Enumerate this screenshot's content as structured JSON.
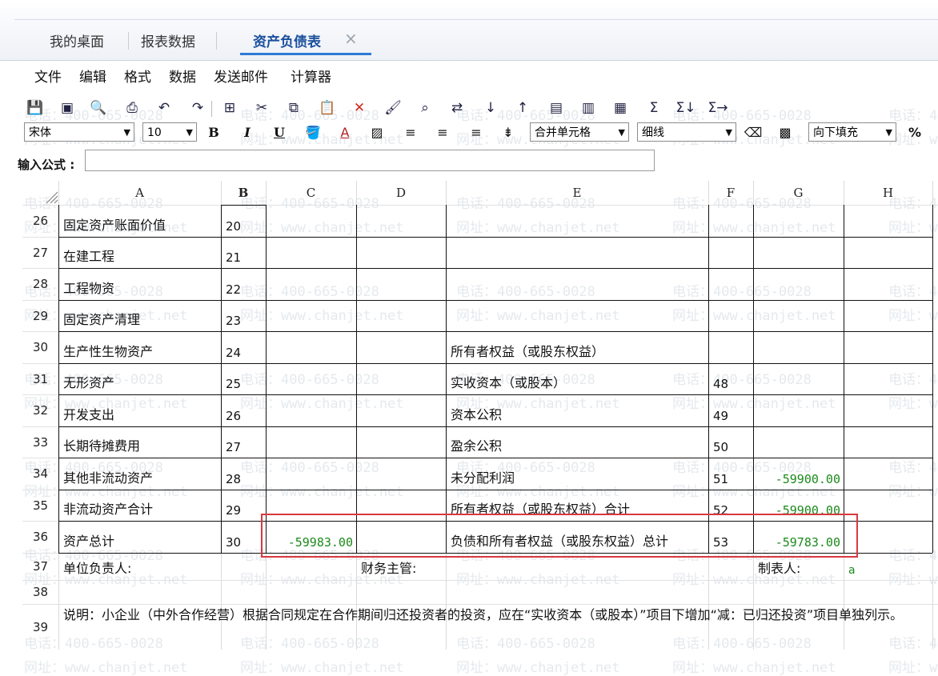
{
  "tabs": [
    {
      "label": "我的桌面",
      "active": false
    },
    {
      "label": "报表数据",
      "active": false
    },
    {
      "label": "资产负债表",
      "active": true
    }
  ],
  "tab_close_icon": "×",
  "menu": [
    "文件",
    "编辑",
    "格式",
    "数据",
    "发送邮件",
    "计算器"
  ],
  "toolbar": {
    "icons": [
      "save-icon",
      "save-as-icon",
      "print-preview-icon",
      "print-icon",
      "undo-icon",
      "redo-icon",
      "select-all-icon",
      "cut-icon",
      "copy-icon",
      "paste-icon",
      "delete-icon",
      "format-painter-icon",
      "find-icon",
      "replace-icon",
      "sort-asc-icon",
      "sort-desc-icon",
      "paste-special-icon",
      "paste-values-icon",
      "insert-icon",
      "sum-icon",
      "sum-row-icon",
      "sum-col-icon"
    ],
    "font": "宋体",
    "font_size": "10",
    "bold_label": "B",
    "italic_label": "I",
    "underline_label": "U",
    "merge_label": "合并单元格",
    "border_label": "细线",
    "fill_label": "向下填充",
    "percent_label": "%"
  },
  "formula": {
    "label": "输入公式 :",
    "value": ""
  },
  "columns": [
    "A",
    "B",
    "C",
    "D",
    "E",
    "F",
    "G",
    "H"
  ],
  "rows": [
    {
      "num": "26",
      "a": "固定资产账面价值",
      "b": "20",
      "c": "",
      "e": "",
      "f": "",
      "g": ""
    },
    {
      "num": "27",
      "a": "在建工程",
      "b": "21",
      "c": "",
      "e": "",
      "f": "",
      "g": ""
    },
    {
      "num": "28",
      "a": "工程物资",
      "b": "22",
      "c": "",
      "e": "",
      "f": "",
      "g": ""
    },
    {
      "num": "29",
      "a": "固定资产清理",
      "b": "23",
      "c": "",
      "e": "",
      "f": "",
      "g": ""
    },
    {
      "num": "30",
      "a": "生产性生物资产",
      "b": "24",
      "c": "",
      "e": "所有者权益（或股东权益）",
      "f": "",
      "g": ""
    },
    {
      "num": "31",
      "a": "无形资产",
      "b": "25",
      "c": "",
      "e": "实收资本（或股本）",
      "f": "48",
      "g": ""
    },
    {
      "num": "32",
      "a": "开发支出",
      "b": "26",
      "c": "",
      "e": "资本公积",
      "f": "49",
      "g": ""
    },
    {
      "num": "33",
      "a": "长期待摊费用",
      "b": "27",
      "c": "",
      "e": "盈余公积",
      "f": "50",
      "g": ""
    },
    {
      "num": "34",
      "a": "其他非流动资产",
      "b": "28",
      "c": "",
      "e": "未分配利润",
      "f": "51",
      "g": "-59900.00"
    },
    {
      "num": "35",
      "a": "非流动资产合计",
      "b": "29",
      "c": "",
      "e": "所有者权益（或股东权益）合计",
      "f": "52",
      "g": "-59900.00"
    },
    {
      "num": "36",
      "a": "资产总计",
      "b": "30",
      "c": "-59983.00",
      "e": "负债和所有者权益（或股东权益）总计",
      "f": "53",
      "g": "-59783.00"
    }
  ],
  "row37": {
    "num": "37",
    "a": "单位负责人:",
    "d": "财务主管:",
    "g": "制表人:",
    "h": "a"
  },
  "row38": {
    "num": "38"
  },
  "row39": {
    "num": "39",
    "note": "说明：小企业（中外合作经营）根据合同规定在合作期间归还投资者的投资，应在“实收资本（或股本）”项目下增加“减：已归还投资”项目单独列示。"
  },
  "watermark": {
    "phone": "电话：400-665-0028",
    "site": "网址：www.chanjet.net"
  }
}
